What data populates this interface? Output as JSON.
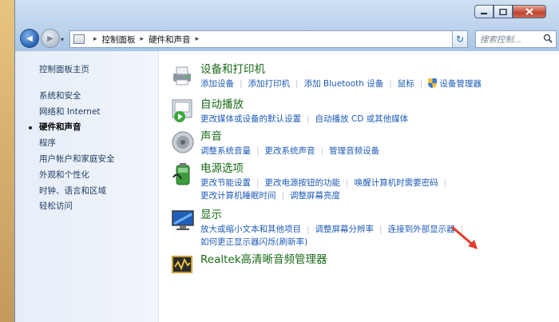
{
  "window": {
    "minimize_icon": "minimize-icon",
    "maximize_icon": "maximize-icon",
    "close_icon": "close-icon"
  },
  "nav": {
    "breadcrumb": [
      "控制面板",
      "硬件和声音"
    ],
    "search_placeholder": "搜索控制...",
    "dropdown_glyph": "▾",
    "back_glyph": "◀",
    "forward_glyph": "▶",
    "refresh_glyph": "↻"
  },
  "sidebar": {
    "items": [
      {
        "label": "控制面板主页"
      },
      {
        "label": "系统和安全"
      },
      {
        "label": "网络和 Internet"
      },
      {
        "label": "硬件和声音"
      },
      {
        "label": "程序"
      },
      {
        "label": "用户帐户和家庭安全"
      },
      {
        "label": "外观和个性化"
      },
      {
        "label": "时钟、语言和区域"
      },
      {
        "label": "轻松访问"
      }
    ],
    "active_index": 3
  },
  "categories": [
    {
      "title": "设备和打印机",
      "icon": "printer-icon",
      "rows": [
        [
          "添加设备",
          "添加打印机",
          "添加 Bluetooth 设备",
          "鼠标",
          "设备管理器"
        ]
      ]
    },
    {
      "title": "自动播放",
      "icon": "autoplay-icon",
      "rows": [
        [
          "更改媒体或设备的默认设置",
          "自动播放 CD 或其他媒体"
        ]
      ]
    },
    {
      "title": "声音",
      "icon": "speaker-icon",
      "rows": [
        [
          "调整系统音量",
          "更改系统声音",
          "管理音频设备"
        ]
      ]
    },
    {
      "title": "电源选项",
      "icon": "battery-icon",
      "rows": [
        [
          "更改节能设置",
          "更改电源按钮的功能",
          "唤醒计算机时需要密码"
        ],
        [
          "更改计算机睡眠时间",
          "调整屏幕亮度"
        ]
      ]
    },
    {
      "title": "显示",
      "icon": "monitor-icon",
      "rows": [
        [
          "放大或缩小文本和其他项目",
          "调整屏幕分辨率",
          "连接到外部显示器"
        ],
        [
          "如何更正显示器闪烁(刷新率)"
        ]
      ]
    },
    {
      "title": "Realtek高清晰音频管理器",
      "icon": "realtek-audio-icon",
      "rows": []
    }
  ]
}
